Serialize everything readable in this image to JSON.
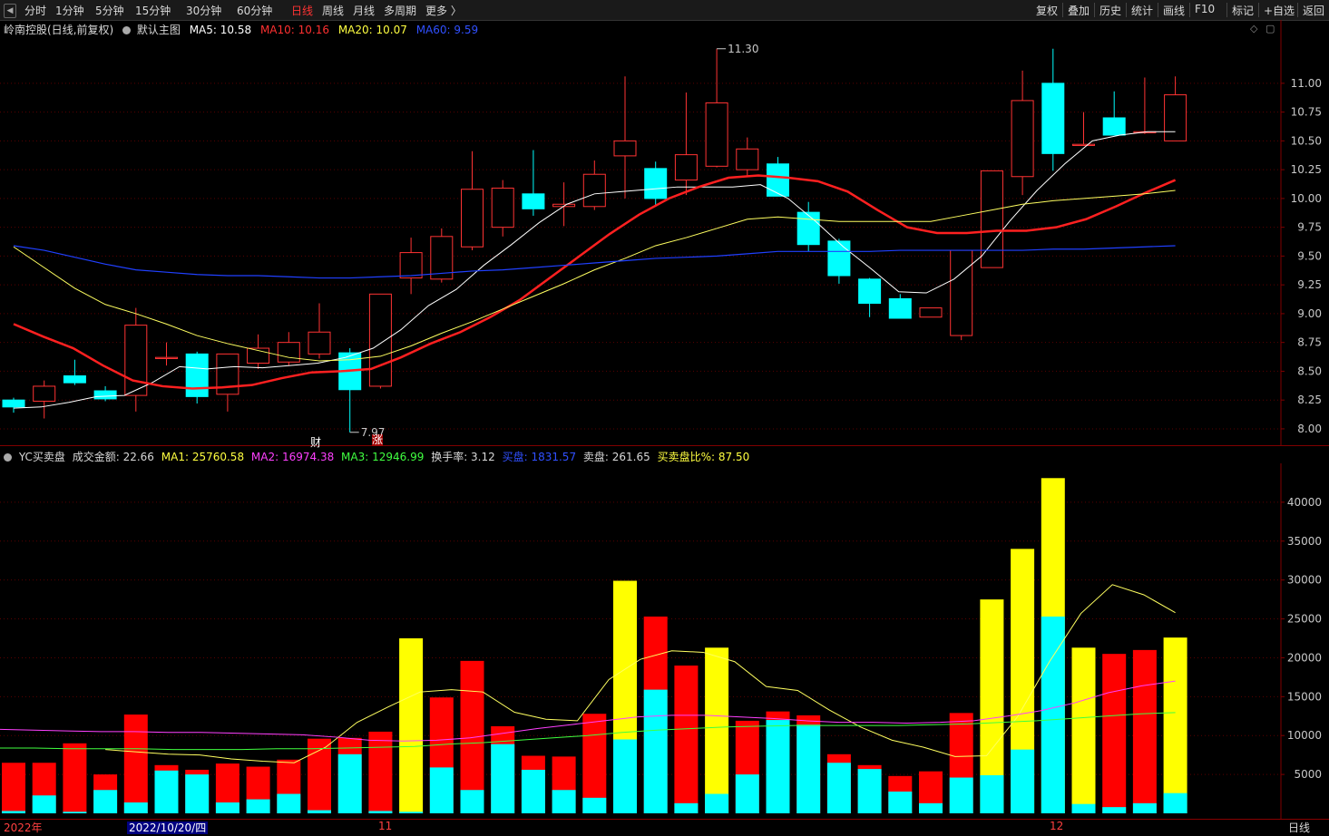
{
  "toolbar": {
    "periods": [
      {
        "label": "分时",
        "active": false
      },
      {
        "label": "1分钟",
        "active": false
      },
      {
        "label": "5分钟",
        "active": false
      },
      {
        "label": "15分钟",
        "active": false
      },
      {
        "label": "30分钟",
        "active": false
      },
      {
        "label": "60分钟",
        "active": false
      },
      {
        "label": "日线",
        "active": true
      },
      {
        "label": "周线",
        "active": false
      },
      {
        "label": "月线",
        "active": false
      },
      {
        "label": "多周期",
        "active": false
      },
      {
        "label": "更多 〉",
        "active": false
      }
    ],
    "right_buttons": [
      "复权",
      "叠加",
      "历史",
      "统计",
      "画线",
      "F10",
      "标记",
      "+自选",
      "返回"
    ]
  },
  "main_header": {
    "stock_name": "岭南控股(日线,前复权)",
    "template": "默认主图",
    "ma5": "MA5: 10.58",
    "ma10": "MA10: 10.16",
    "ma20": "MA20: 10.07",
    "ma60": "MA60: 9.59"
  },
  "vol_header": {
    "indicator": "YC买卖盘",
    "amount": "成交金额: 22.66",
    "ma1": "MA1: 25760.58",
    "ma2": "MA2: 16974.38",
    "ma3": "MA3: 12946.99",
    "turnover": "换手率: 3.12",
    "buy": "买盘: 1831.57",
    "sell": "卖盘: 261.65",
    "ratio": "买卖盘比%: 87.50"
  },
  "colors": {
    "up": "#ff3333",
    "down": "#00ffff",
    "ma5": "#ffffff",
    "ma10": "#ff2020",
    "ma20": "#ffff60",
    "ma60": "#2040ff",
    "buy": "#00ffff",
    "sell": "#ff0000",
    "neutral": "#ffff00"
  },
  "footer": {
    "year_label": "2022年",
    "selected_date": "2022/10/20/四",
    "month_11": "11",
    "month_12": "12",
    "period": "日线"
  },
  "markers": {
    "cai": "财",
    "zhang": "涨"
  },
  "chart_data": [
    {
      "type": "candlestick",
      "title": "岭南控股(日线,前复权)",
      "ylim": [
        7.85,
        11.55
      ],
      "y_ticks": [
        "11.00",
        "10.75",
        "10.50",
        "10.25",
        "10.00",
        "9.75",
        "9.50",
        "9.25",
        "9.00",
        "8.75",
        "8.50",
        "8.25",
        "8.00"
      ],
      "annotations": [
        {
          "text": "11.30",
          "value": 11.3
        },
        {
          "text": "7.97",
          "value": 7.97
        }
      ],
      "ohlc": [
        [
          8.25,
          8.27,
          8.14,
          8.19
        ],
        [
          8.24,
          8.42,
          8.09,
          8.37
        ],
        [
          8.46,
          8.6,
          8.38,
          8.4
        ],
        [
          8.33,
          8.37,
          8.24,
          8.26
        ],
        [
          8.29,
          9.05,
          8.15,
          8.9
        ],
        [
          8.61,
          8.75,
          8.55,
          8.62
        ],
        [
          8.65,
          8.67,
          8.22,
          8.28
        ],
        [
          8.3,
          8.62,
          8.15,
          8.65
        ],
        [
          8.57,
          8.82,
          8.52,
          8.7
        ],
        [
          8.58,
          8.84,
          8.55,
          8.75
        ],
        [
          8.65,
          9.09,
          8.61,
          8.84
        ],
        [
          8.66,
          8.7,
          7.97,
          8.34
        ],
        [
          8.37,
          9.17,
          8.35,
          9.17
        ],
        [
          9.31,
          9.66,
          9.17,
          9.53
        ],
        [
          9.3,
          9.74,
          9.27,
          9.67
        ],
        [
          9.58,
          10.41,
          9.55,
          10.08
        ],
        [
          9.75,
          10.16,
          9.67,
          10.09
        ],
        [
          10.04,
          10.42,
          9.85,
          9.91
        ],
        [
          9.93,
          10.14,
          9.76,
          9.95
        ],
        [
          9.93,
          10.33,
          9.9,
          10.21
        ],
        [
          10.37,
          11.06,
          10.0,
          10.5
        ],
        [
          10.26,
          10.32,
          9.94,
          10.0
        ],
        [
          10.16,
          10.92,
          10.03,
          10.38
        ],
        [
          10.28,
          11.3,
          10.27,
          10.83
        ],
        [
          10.25,
          10.53,
          10.2,
          10.43
        ],
        [
          10.3,
          10.36,
          10.02,
          10.02
        ],
        [
          9.88,
          9.97,
          9.54,
          9.6
        ],
        [
          9.63,
          9.65,
          9.26,
          9.33
        ],
        [
          9.3,
          9.31,
          8.97,
          9.09
        ],
        [
          9.13,
          9.17,
          8.97,
          8.96
        ],
        [
          8.97,
          9.05,
          8.97,
          9.05
        ],
        [
          8.81,
          9.55,
          8.77,
          9.55
        ],
        [
          9.4,
          10.23,
          9.4,
          10.24
        ],
        [
          10.19,
          11.11,
          10.03,
          10.85
        ],
        [
          11.0,
          11.3,
          10.24,
          10.39
        ],
        [
          10.46,
          10.75,
          10.46,
          10.47
        ],
        [
          10.7,
          10.93,
          10.56,
          10.55
        ],
        [
          10.57,
          11.05,
          10.56,
          10.58
        ],
        [
          10.5,
          11.06,
          10.5,
          10.9
        ]
      ],
      "series": [
        {
          "name": "MA5",
          "values": [
            8.18,
            8.19,
            8.23,
            8.28,
            8.29,
            8.4,
            8.54,
            8.52,
            8.54,
            8.53,
            8.55,
            8.57,
            8.62,
            8.7,
            8.86,
            9.07,
            9.21,
            9.42,
            9.6,
            9.79,
            9.95,
            10.04,
            10.06,
            10.08,
            10.1,
            10.1,
            10.1,
            10.12,
            10.0,
            9.8,
            9.58,
            9.39,
            9.19,
            9.18,
            9.3,
            9.5,
            9.8,
            10.07,
            10.3,
            10.5,
            10.55,
            10.58,
            10.58
          ]
        },
        {
          "name": "MA10",
          "values": [
            8.91,
            8.8,
            8.7,
            8.55,
            8.42,
            8.37,
            8.35,
            8.36,
            8.38,
            8.44,
            8.49,
            8.5,
            8.52,
            8.62,
            8.74,
            8.84,
            8.97,
            9.12,
            9.31,
            9.5,
            9.69,
            9.86,
            10.0,
            10.1,
            10.18,
            10.2,
            10.18,
            10.15,
            10.06,
            9.9,
            9.75,
            9.7,
            9.7,
            9.72,
            9.72,
            9.75,
            9.82,
            9.93,
            10.05,
            10.16
          ]
        },
        {
          "name": "MA20",
          "values": [
            9.58,
            9.4,
            9.22,
            9.08,
            9.0,
            8.91,
            8.81,
            8.74,
            8.68,
            8.62,
            8.59,
            8.6,
            8.63,
            8.72,
            8.83,
            8.93,
            9.04,
            9.15,
            9.26,
            9.38,
            9.48,
            9.59,
            9.66,
            9.74,
            9.82,
            9.84,
            9.82,
            9.8,
            9.8,
            9.8,
            9.8,
            9.85,
            9.9,
            9.95,
            9.98,
            10.0,
            10.02,
            10.04,
            10.07
          ]
        },
        {
          "name": "MA60",
          "values": [
            9.59,
            9.55,
            9.49,
            9.43,
            9.38,
            9.36,
            9.34,
            9.33,
            9.33,
            9.32,
            9.31,
            9.31,
            9.32,
            9.33,
            9.35,
            9.37,
            9.38,
            9.4,
            9.42,
            9.44,
            9.46,
            9.48,
            9.49,
            9.5,
            9.52,
            9.54,
            9.54,
            9.54,
            9.54,
            9.55,
            9.55,
            9.55,
            9.55,
            9.55,
            9.56,
            9.56,
            9.57,
            9.58,
            9.59
          ]
        }
      ]
    },
    {
      "type": "bar",
      "title": "YC买卖盘",
      "ylim": [
        0,
        45000
      ],
      "y_ticks": [
        "40000",
        "35000",
        "30000",
        "25000",
        "20000",
        "15000",
        "10000",
        "5000"
      ],
      "total": [
        6500,
        6500,
        9000,
        5000,
        12700,
        6200,
        5600,
        6400,
        6000,
        6900,
        9600,
        9700,
        10500,
        22500,
        14900,
        19600,
        11200,
        7400,
        7300,
        12800,
        29900,
        25300,
        19000,
        21300,
        11900,
        13100,
        12600,
        7600,
        6200,
        4800,
        5400,
        12900,
        27500,
        34000,
        43100,
        21300,
        20500,
        21000,
        22600
      ],
      "buy": [
        300,
        2300,
        200,
        3000,
        1400,
        5500,
        5000,
        1400,
        1800,
        2500,
        400,
        7600,
        300,
        200,
        5900,
        3000,
        8900,
        5600,
        3000,
        2000,
        9500,
        15900,
        1300,
        2500,
        5000,
        12000,
        11400,
        6500,
        5700,
        2800,
        1300,
        4600,
        4900,
        8200,
        25300,
        1200,
        800,
        1300,
        2600
      ],
      "neutral": [
        false,
        false,
        false,
        false,
        false,
        false,
        false,
        false,
        false,
        false,
        false,
        false,
        false,
        true,
        false,
        false,
        false,
        false,
        false,
        false,
        true,
        false,
        false,
        true,
        false,
        false,
        false,
        false,
        false,
        false,
        false,
        false,
        true,
        true,
        true,
        true,
        false,
        false,
        true
      ],
      "series": [
        {
          "name": "MA1",
          "values": [
            8200,
            7900,
            7600,
            7500,
            7000,
            6700,
            6500,
            8500,
            11700,
            13700,
            15600,
            15900,
            15600,
            13000,
            12100,
            11900,
            17200,
            19800,
            20900,
            20700,
            19500,
            16300,
            15800,
            13300,
            11100,
            9400,
            8500,
            7300,
            7400,
            12500,
            19500,
            25700,
            29400,
            28100,
            25800
          ]
        },
        {
          "name": "MA2",
          "values": [
            10800,
            10700,
            10600,
            10500,
            10500,
            10400,
            10400,
            10300,
            10200,
            10100,
            9800,
            9400,
            9300,
            9400,
            9700,
            10300,
            10900,
            11400,
            11900,
            12400,
            12600,
            12600,
            12400,
            12200,
            11900,
            11700,
            11700,
            11600,
            11700,
            11900,
            12500,
            13200,
            14200,
            15500,
            16400,
            17000
          ]
        },
        {
          "name": "MA3",
          "values": [
            8400,
            8400,
            8300,
            8300,
            8300,
            8200,
            8200,
            8200,
            8300,
            8300,
            8400,
            8500,
            8600,
            8900,
            9100,
            9400,
            9700,
            10000,
            10400,
            10700,
            10900,
            11100,
            11200,
            11300,
            11300,
            11300,
            11300,
            11400,
            11500,
            11700,
            11900,
            12200,
            12500,
            12800,
            12950
          ]
        }
      ]
    }
  ]
}
